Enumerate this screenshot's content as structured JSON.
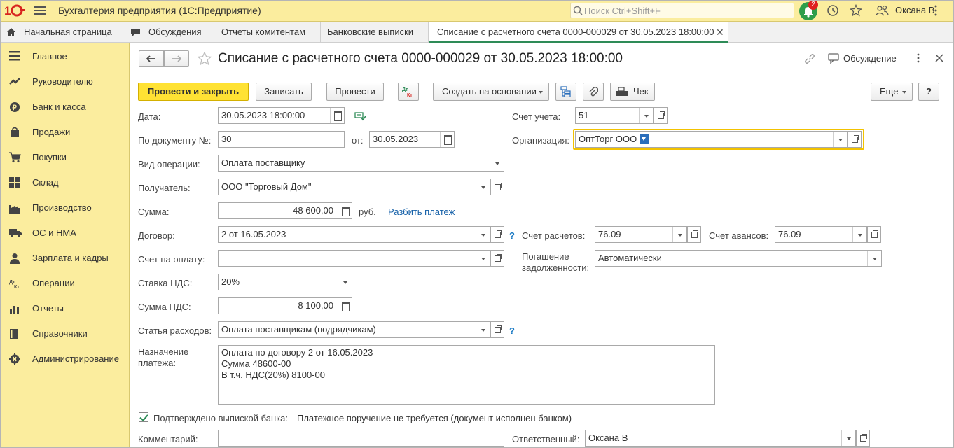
{
  "app": {
    "title": "Бухгалтерия предприятия  (1С:Предприятие)",
    "search_placeholder": "Поиск Ctrl+Shift+F",
    "notifications_count": "2",
    "user_name": "Оксана В"
  },
  "tabs": [
    {
      "label": "Начальная страница"
    },
    {
      "label": "Обсуждения"
    },
    {
      "label": "Отчеты комитентам"
    },
    {
      "label": "Банковские выписки"
    },
    {
      "label": "Списание с расчетного счета 0000-000029 от 30.05.2023 18:00:00"
    }
  ],
  "sidebar": {
    "items": [
      {
        "label": "Главное",
        "icon": "menu-lines-icon"
      },
      {
        "label": "Руководителю",
        "icon": "trend-chart-icon"
      },
      {
        "label": "Банк и касса",
        "icon": "ruble-coin-icon"
      },
      {
        "label": "Продажи",
        "icon": "shopping-bag-icon"
      },
      {
        "label": "Покупки",
        "icon": "shopping-cart-icon"
      },
      {
        "label": "Склад",
        "icon": "warehouse-grid-icon"
      },
      {
        "label": "Производство",
        "icon": "factory-icon"
      },
      {
        "label": "ОС и НМА",
        "icon": "truck-icon"
      },
      {
        "label": "Зарплата и кадры",
        "icon": "person-icon"
      },
      {
        "label": "Операции",
        "icon": "debit-credit-icon"
      },
      {
        "label": "Отчеты",
        "icon": "bar-chart-icon"
      },
      {
        "label": "Справочники",
        "icon": "book-icon"
      },
      {
        "label": "Администрирование",
        "icon": "gear-icon"
      }
    ]
  },
  "doc": {
    "title": "Списание с расчетного счета 0000-000029 от 30.05.2023 18:00:00",
    "discussion_label": "Обсуждение"
  },
  "toolbar": {
    "post_close": "Провести и закрыть",
    "save": "Записать",
    "post": "Провести",
    "create_based": "Создать на основании",
    "receipt": "Чек",
    "more": "Еще",
    "help": "?",
    "dt_kt": "Дт Кт"
  },
  "form": {
    "date_label": "Дата:",
    "date_value": "30.05.2023 18:00:00",
    "account_label": "Счет учета:",
    "account_value": "51",
    "doc_no_label": "По документу №:",
    "doc_no_value": "30",
    "from_label": "от:",
    "from_value": "30.05.2023",
    "org_label": "Организация:",
    "org_value": "ОптТорг ООО",
    "op_type_label": "Вид операции:",
    "op_type_value": "Оплата поставщику",
    "recipient_label": "Получатель:",
    "recipient_value": "ООО \"Торговый Дом\"",
    "sum_label": "Сумма:",
    "sum_value": "48 600,00",
    "currency": "руб.",
    "split_link": "Разбить платеж",
    "contract_label": "Договор:",
    "contract_value": "2 от 16.05.2023",
    "settle_acc_label": "Счет расчетов:",
    "settle_acc_value": "76.09",
    "adv_acc_label": "Счет авансов:",
    "adv_acc_value": "76.09",
    "invoice_label": "Счет на оплату:",
    "invoice_value": "",
    "repay_label_1": "Погашение",
    "repay_label_2": "задолженности:",
    "repay_value": "Автоматически",
    "vat_rate_label": "Ставка НДС:",
    "vat_rate_value": "20%",
    "vat_sum_label": "Сумма НДС:",
    "vat_sum_value": "8 100,00",
    "expense_label": "Статья расходов:",
    "expense_value": "Оплата поставщикам (подрядчикам)",
    "purpose_label_1": "Назначение",
    "purpose_label_2": "платежа:",
    "purpose_value": "Оплата по договору 2 от 16.05.2023\nСумма 48600-00\nВ т.ч. НДС(20%) 8100-00",
    "confirmed_label": "Подтверждено выпиской банка:",
    "confirmed_checked": true,
    "payment_order_note": "Платежное поручение не требуется (документ исполнен банком)",
    "comment_label": "Комментарий:",
    "comment_value": "",
    "responsible_label": "Ответственный:",
    "responsible_value": "Оксана В",
    "help_mark": "?"
  }
}
